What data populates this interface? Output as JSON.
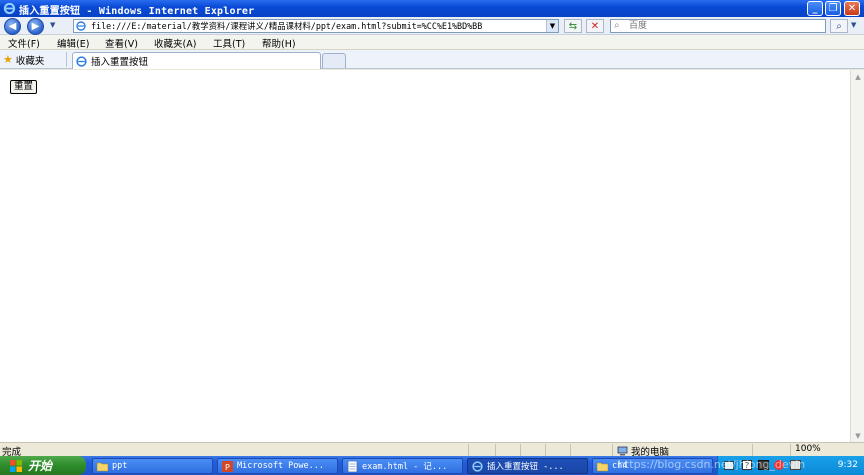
{
  "window": {
    "title": "插入重置按钮 - Windows Internet Explorer"
  },
  "address_bar": {
    "url": "file:///E:/material/教学资料/课程讲义/精品课材料/ppt/exam.html?submit=%CC%E1%BD%BB"
  },
  "search": {
    "placeholder": "百度"
  },
  "menu": {
    "items": [
      "文件(F)",
      "编辑(E)",
      "查看(V)",
      "收藏夹(A)",
      "工具(T)",
      "帮助(H)"
    ]
  },
  "favorites": {
    "label": "收藏夹"
  },
  "tabs": [
    {
      "label": "插入重置按钮"
    }
  ],
  "content": {
    "reset_button_label": "重置"
  },
  "status_bar": {
    "text": "完成",
    "zone": "我的电脑",
    "zoom": "100%"
  },
  "taskbar": {
    "start_label": "开始",
    "buttons": [
      {
        "label": "ppt"
      },
      {
        "label": "Microsoft Powe..."
      },
      {
        "label": "exam.html - 记..."
      },
      {
        "label": "插入重置按钮 -..."
      },
      {
        "label": "ch4"
      }
    ],
    "clock": "9:32"
  },
  "watermark": "https://blog.csdn.net/jhlong_devin",
  "icons": {
    "ie": "ie-logo-icon",
    "back": "back-arrow-icon",
    "forward": "forward-arrow-icon",
    "refresh": "refresh-icon",
    "stop": "stop-icon",
    "search": "magnifier-icon",
    "star": "star-icon",
    "computer": "computer-icon",
    "folder": "folder-icon"
  },
  "colors": {
    "titlebar": "#0a4ad6",
    "taskbar": "#245edb",
    "start": "#2e8c2b"
  }
}
